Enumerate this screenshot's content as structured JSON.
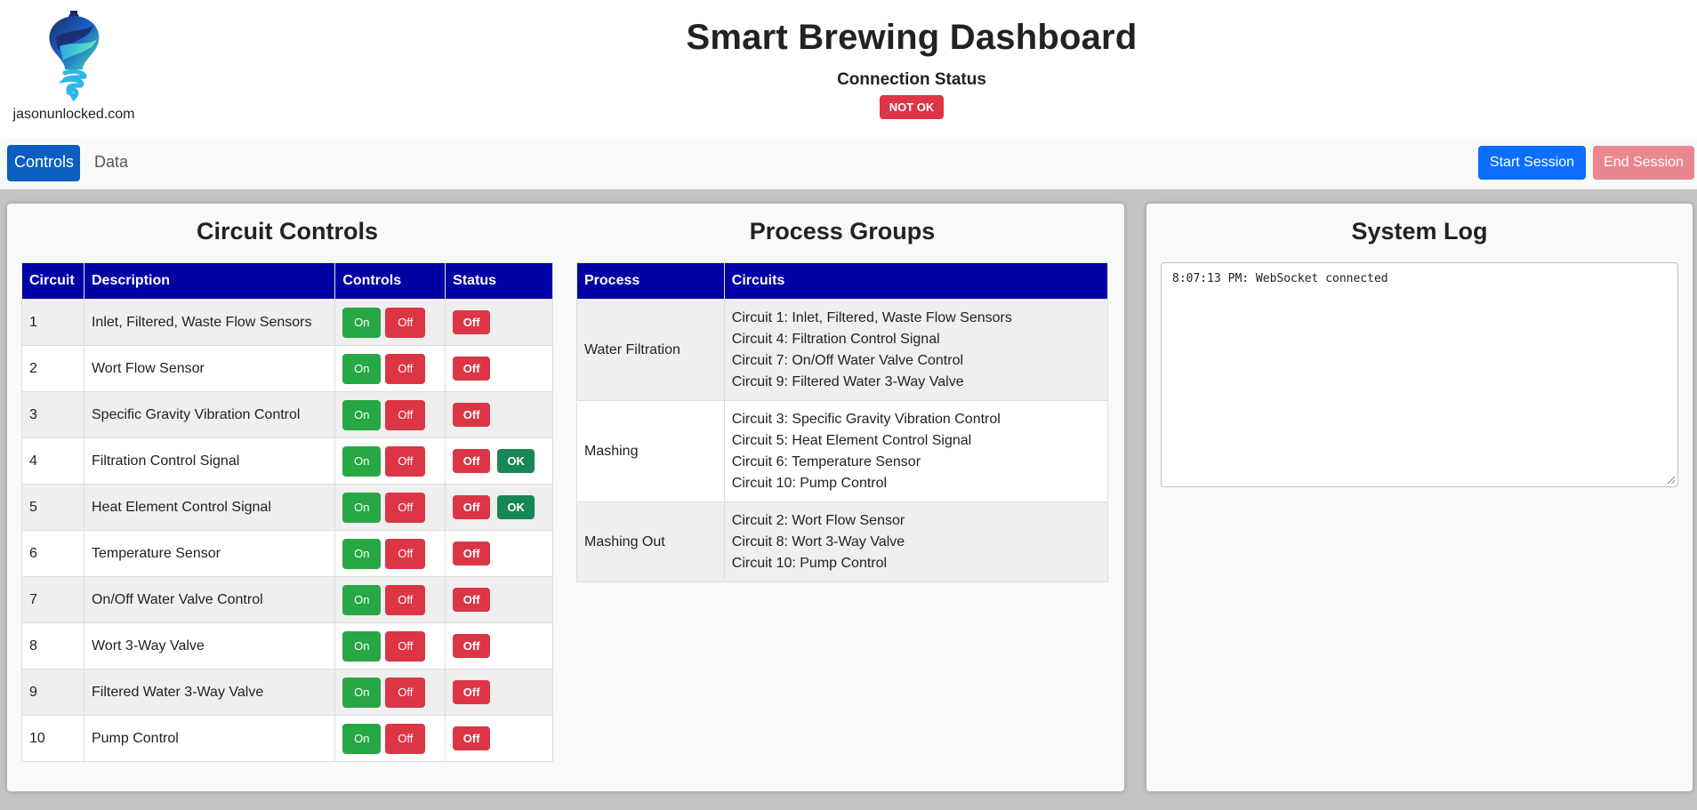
{
  "brand": {
    "site": "jasonunlocked.com"
  },
  "header": {
    "title": "Smart Brewing Dashboard",
    "connection_label": "Connection Status",
    "connection_badge": "NOT OK"
  },
  "nav": {
    "tabs": [
      {
        "label": "Controls",
        "active": true
      },
      {
        "label": "Data",
        "active": false
      }
    ],
    "start_label": "Start Session",
    "end_label": "End Session"
  },
  "circuit_controls": {
    "title": "Circuit Controls",
    "headers": [
      "Circuit",
      "Description",
      "Controls",
      "Status"
    ],
    "on_label": "On",
    "off_label": "Off",
    "rows": [
      {
        "circuit": "1",
        "description": "Inlet, Filtered, Waste Flow Sensors",
        "status": "Off",
        "extra": ""
      },
      {
        "circuit": "2",
        "description": "Wort Flow Sensor",
        "status": "Off",
        "extra": ""
      },
      {
        "circuit": "3",
        "description": "Specific Gravity Vibration Control",
        "status": "Off",
        "extra": ""
      },
      {
        "circuit": "4",
        "description": "Filtration Control Signal",
        "status": "Off",
        "extra": "OK"
      },
      {
        "circuit": "5",
        "description": "Heat Element Control Signal",
        "status": "Off",
        "extra": "OK"
      },
      {
        "circuit": "6",
        "description": "Temperature Sensor",
        "status": "Off",
        "extra": ""
      },
      {
        "circuit": "7",
        "description": "On/Off Water Valve Control",
        "status": "Off",
        "extra": ""
      },
      {
        "circuit": "8",
        "description": "Wort 3-Way Valve",
        "status": "Off",
        "extra": ""
      },
      {
        "circuit": "9",
        "description": "Filtered Water 3-Way Valve",
        "status": "Off",
        "extra": ""
      },
      {
        "circuit": "10",
        "description": "Pump Control",
        "status": "Off",
        "extra": ""
      }
    ]
  },
  "process_groups": {
    "title": "Process Groups",
    "headers": [
      "Process",
      "Circuits"
    ],
    "rows": [
      {
        "process": "Water Filtration",
        "circuits": [
          "Circuit 1: Inlet, Filtered, Waste Flow Sensors",
          "Circuit 4: Filtration Control Signal",
          "Circuit 7: On/Off Water Valve Control",
          "Circuit 9: Filtered Water 3-Way Valve"
        ]
      },
      {
        "process": "Mashing",
        "circuits": [
          "Circuit 3: Specific Gravity Vibration Control",
          "Circuit 5: Heat Element Control Signal",
          "Circuit 6: Temperature Sensor",
          "Circuit 10: Pump Control"
        ]
      },
      {
        "process": "Mashing Out",
        "circuits": [
          "Circuit 2: Wort Flow Sensor",
          "Circuit 8: Wort 3-Way Valve",
          "Circuit 10: Pump Control"
        ]
      }
    ]
  },
  "system_log": {
    "title": "System Log",
    "entries": [
      "8:07:13 PM: WebSocket connected"
    ]
  },
  "colors": {
    "table_header": "#0000a4",
    "primary": "#0d6efd",
    "danger": "#dc3545",
    "success": "#28a745",
    "ok": "#198754"
  },
  "icons": {
    "logo": "bulb-gear-logo-icon",
    "resize_handle": "resize-grip-icon"
  }
}
